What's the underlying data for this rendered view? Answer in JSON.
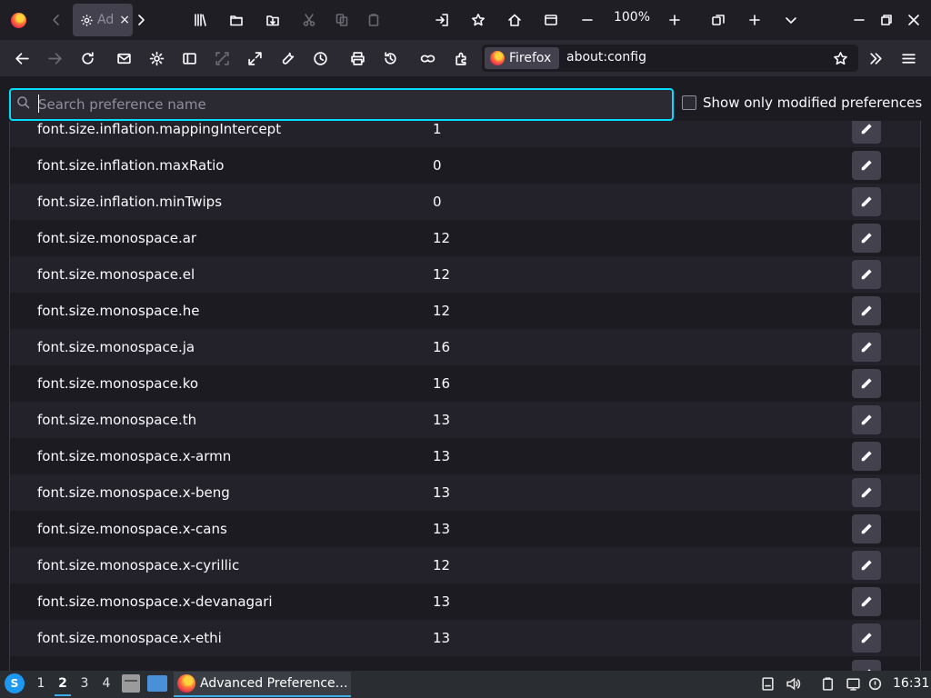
{
  "browser": {
    "tab": {
      "title": "Ad",
      "close_glyph": "×"
    },
    "zoom": "100%",
    "identity_label": "Firefox",
    "url": "about:config"
  },
  "search": {
    "placeholder": "Search preference name",
    "value": "",
    "modified_only_label": "Show only modified preferences"
  },
  "prefs": [
    {
      "name": "font.size.inflation.mappingIntercept",
      "value": "1"
    },
    {
      "name": "font.size.inflation.maxRatio",
      "value": "0"
    },
    {
      "name": "font.size.inflation.minTwips",
      "value": "0"
    },
    {
      "name": "font.size.monospace.ar",
      "value": "12"
    },
    {
      "name": "font.size.monospace.el",
      "value": "12"
    },
    {
      "name": "font.size.monospace.he",
      "value": "12"
    },
    {
      "name": "font.size.monospace.ja",
      "value": "16"
    },
    {
      "name": "font.size.monospace.ko",
      "value": "16"
    },
    {
      "name": "font.size.monospace.th",
      "value": "13"
    },
    {
      "name": "font.size.monospace.x-armn",
      "value": "13"
    },
    {
      "name": "font.size.monospace.x-beng",
      "value": "13"
    },
    {
      "name": "font.size.monospace.x-cans",
      "value": "13"
    },
    {
      "name": "font.size.monospace.x-cyrillic",
      "value": "12"
    },
    {
      "name": "font.size.monospace.x-devanagari",
      "value": "13"
    },
    {
      "name": "font.size.monospace.x-ethi",
      "value": "13"
    },
    {
      "name": "",
      "value": ""
    }
  ],
  "taskbar": {
    "workspaces": [
      "1",
      "2",
      "3",
      "4"
    ],
    "active_workspace": "2",
    "task_title": "Advanced Preference…",
    "clock": "16:31"
  },
  "colors": {
    "focus_ring": "#00ddff",
    "row_odd": "#23222b",
    "row_even": "#1c1b22",
    "button_bg": "#42414d",
    "taskbar_accent": "#3daee9"
  }
}
